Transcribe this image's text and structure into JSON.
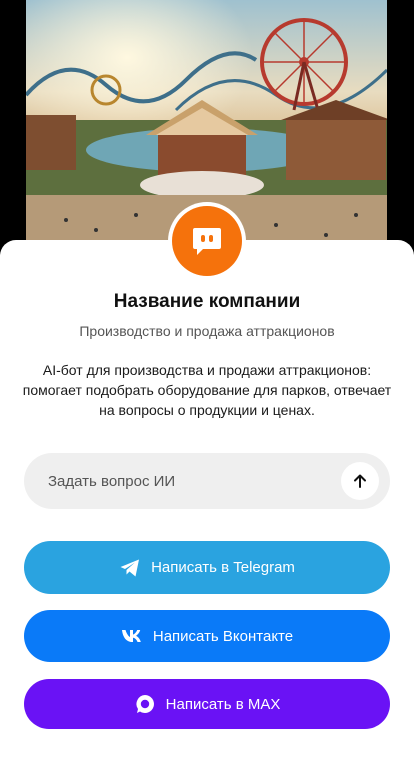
{
  "company": {
    "name": "Название компании",
    "category": "Производство и продажа аттракционов",
    "description": "AI-бот для производства и продажи аттракционов: помогает подобрать оборудование для парков, отвечает на вопросы о продукции и ценах."
  },
  "ask": {
    "placeholder": "Задать вопрос ИИ",
    "send_icon": "arrow-up-icon"
  },
  "buttons": {
    "telegram": {
      "label": "Написать в Telegram",
      "icon": "telegram-icon",
      "color": "#2aa3e0"
    },
    "vk": {
      "label": "Написать Вконтакте",
      "icon": "vk-icon",
      "color": "#0a7af8"
    },
    "max": {
      "label": "Написать в MAX",
      "icon": "max-icon",
      "color": "#6a12f5"
    }
  },
  "avatar": {
    "icon": "chat-bot-icon",
    "color": "#f5720c"
  }
}
